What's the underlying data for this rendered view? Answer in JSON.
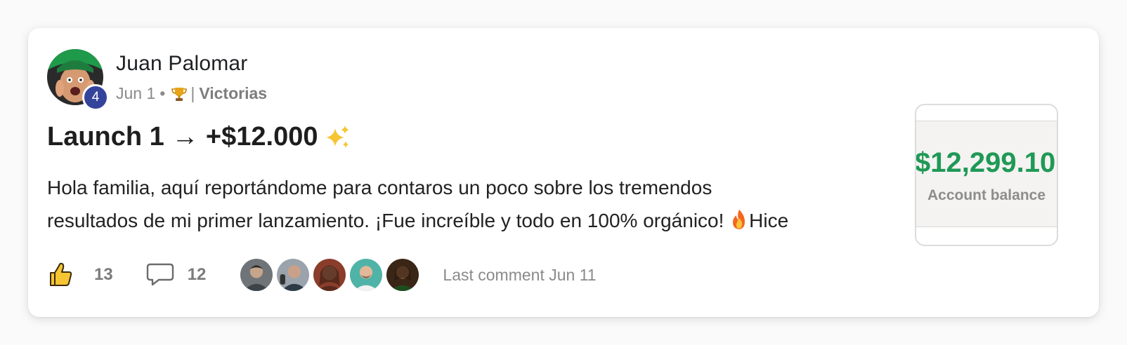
{
  "post": {
    "author": "Juan Palomar",
    "level": "4",
    "date": "Jun 1",
    "separator": "•",
    "category_prefix": "|",
    "category": "Victorias",
    "title": "Launch 1 → +$12.000",
    "body_line1": "Hola familia, aquí reportándome para contaros un poco sobre los tremendos",
    "body_line2": "resultados de mi primer lanzamiento. ¡Fue increíble y todo en 100% orgánico! ",
    "body_line2_after": "Hice"
  },
  "thumbnail": {
    "balance": "$12,299.10",
    "label": "Account balance",
    "accent_color": "#1f9956"
  },
  "footer": {
    "likes": "13",
    "comments": "12",
    "last_comment": "Last comment Jun 11",
    "commenter_avatars": [
      "commenter-1",
      "commenter-2",
      "commenter-3",
      "commenter-4",
      "commenter-5"
    ]
  },
  "icons": {
    "like": "thumbs-up-icon",
    "comment": "speech-bubble-icon",
    "trophy": "trophy-icon",
    "sparkles": "sparkles-icon",
    "fire": "fire-icon"
  },
  "colors": {
    "level_badge": "#35449b",
    "muted_text": "#8a8a8a"
  }
}
